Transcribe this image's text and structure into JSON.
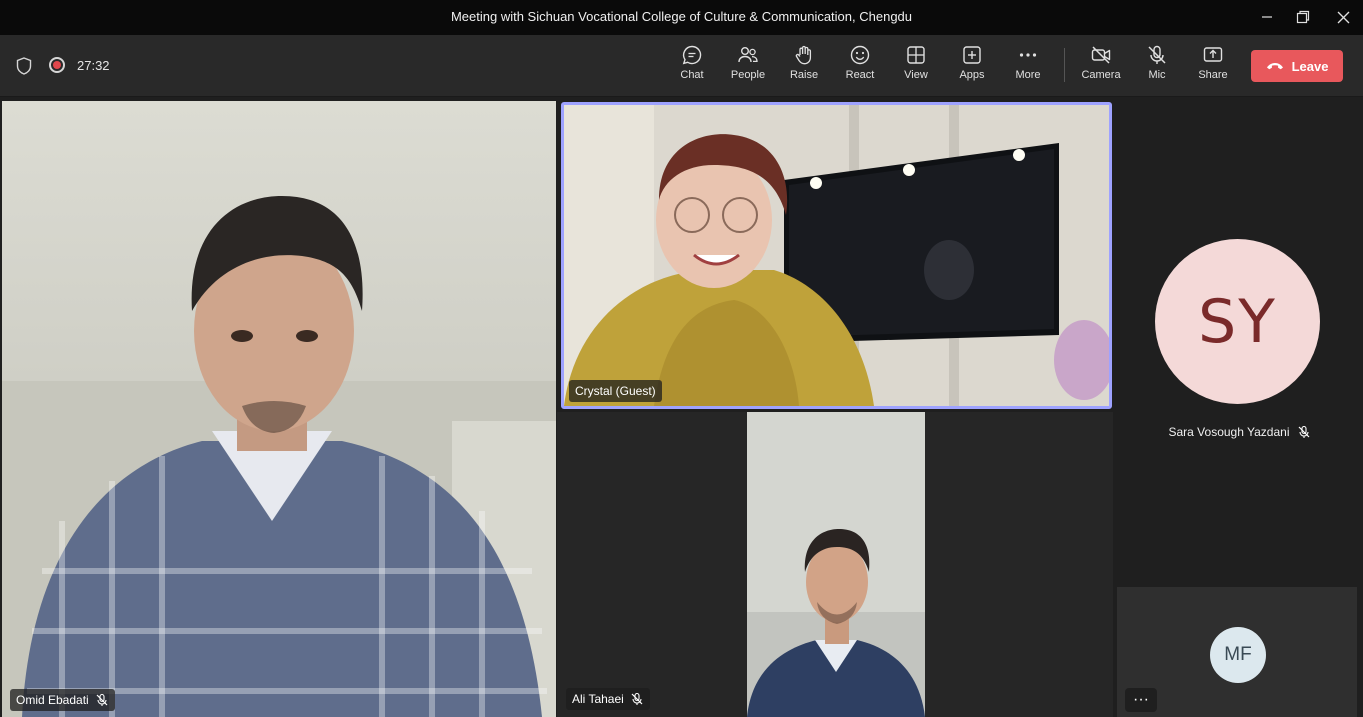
{
  "window": {
    "title": "Meeting with Sichuan Vocational College of Culture & Communication, Chengdu"
  },
  "toolbar": {
    "timer": "27:32",
    "buttons": {
      "chat": "Chat",
      "people": "People",
      "raise": "Raise",
      "react": "React",
      "view": "View",
      "apps": "Apps",
      "more": "More",
      "camera": "Camera",
      "mic": "Mic",
      "share": "Share",
      "leave": "Leave"
    }
  },
  "participants": {
    "omid": {
      "name": "Omid Ebadati",
      "muted": true
    },
    "crystal": {
      "name": "Crystal (Guest)",
      "active_speaker": true
    },
    "ali": {
      "name": "Ali Tahaei",
      "muted": true
    },
    "sara": {
      "name": "Sara Vosough Yazdani",
      "initials": "SY",
      "muted": true
    },
    "mf": {
      "initials": "MF"
    }
  },
  "more_participants_label": "···",
  "colors": {
    "leave_button": "#e8585c",
    "active_speaker_border": "#9ea2ff",
    "sy_avatar_bg": "#f4d9d8",
    "sy_avatar_text": "#7a2a2a",
    "mf_avatar_bg": "#dce8ee",
    "mf_avatar_text": "#3a4a55"
  }
}
